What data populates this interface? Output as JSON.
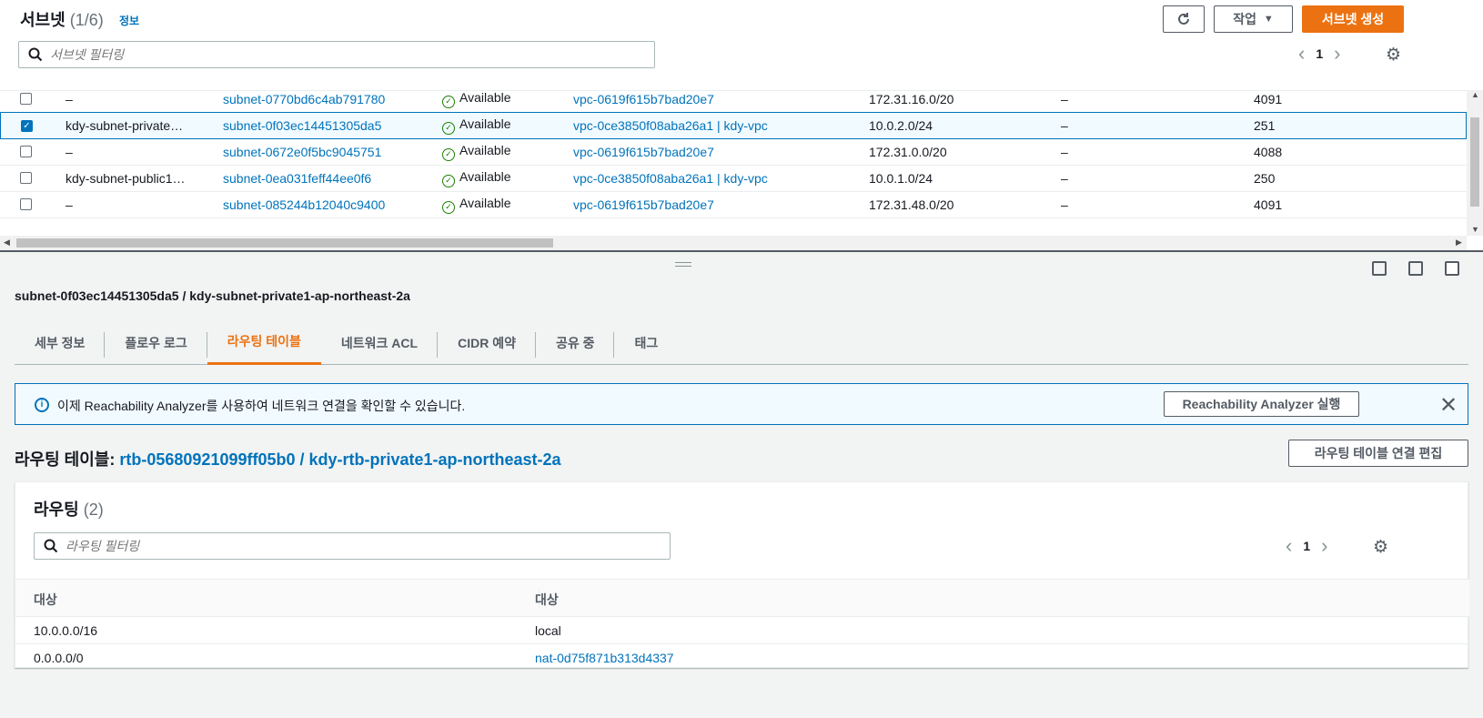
{
  "header": {
    "title": "서브넷",
    "count": "(1/6)",
    "info": "정보",
    "actions_label": "작업",
    "create_label": "서브넷 생성",
    "filter_placeholder": "서브넷 필터링",
    "page": "1"
  },
  "subnets": [
    {
      "name": "–",
      "id": "subnet-0770bd6c4ab791780",
      "state": "Available",
      "vpc": "vpc-0619f615b7bad20e7",
      "cidr": "172.31.16.0/20",
      "ipv6": "–",
      "ips": "4091",
      "checked": false
    },
    {
      "name": "kdy-subnet-private…",
      "id": "subnet-0f03ec14451305da5",
      "state": "Available",
      "vpc": "vpc-0ce3850f08aba26a1 | kdy-vpc",
      "cidr": "10.0.2.0/24",
      "ipv6": "–",
      "ips": "251",
      "checked": true
    },
    {
      "name": "–",
      "id": "subnet-0672e0f5bc9045751",
      "state": "Available",
      "vpc": "vpc-0619f615b7bad20e7",
      "cidr": "172.31.0.0/20",
      "ipv6": "–",
      "ips": "4088",
      "checked": false
    },
    {
      "name": "kdy-subnet-public1…",
      "id": "subnet-0ea031feff44ee0f6",
      "state": "Available",
      "vpc": "vpc-0ce3850f08aba26a1 | kdy-vpc",
      "cidr": "10.0.1.0/24",
      "ipv6": "–",
      "ips": "250",
      "checked": false
    },
    {
      "name": "–",
      "id": "subnet-085244b12040c9400",
      "state": "Available",
      "vpc": "vpc-0619f615b7bad20e7",
      "cidr": "172.31.48.0/20",
      "ipv6": "–",
      "ips": "4091",
      "checked": false
    }
  ],
  "detail": {
    "title": "subnet-0f03ec14451305da5 / kdy-subnet-private1-ap-northeast-2a",
    "tabs": [
      "세부 정보",
      "플로우 로그",
      "라우팅 테이블",
      "네트워크 ACL",
      "CIDR 예약",
      "공유 중",
      "태그"
    ],
    "alert_text": "이제 Reachability Analyzer를 사용하여 네트워크 연결을 확인할 수 있습니다.",
    "alert_button": "Reachability Analyzer 실행",
    "rt_label": "라우팅 테이블:",
    "rt_link": "rtb-05680921099ff05b0 / kdy-rtb-private1-ap-northeast-2a",
    "rt_edit_button": "라우팅 테이블 연결 편집"
  },
  "routes": {
    "title": "라우팅",
    "count": "(2)",
    "filter_placeholder": "라우팅 필터링",
    "page": "1",
    "col_destination": "대상",
    "col_target": "대상",
    "rows": [
      {
        "destination": "10.0.0.0/16",
        "target": "local"
      },
      {
        "destination": "0.0.0.0/0",
        "target": "nat-0d75f871b313d4337"
      }
    ]
  }
}
